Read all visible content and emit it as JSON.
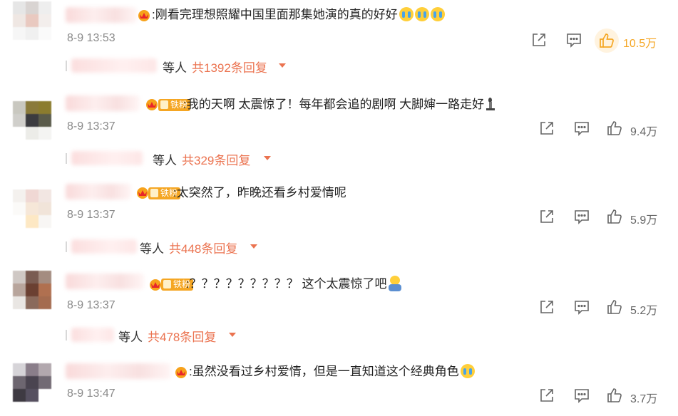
{
  "comments": [
    {
      "text": ":刚看完理想照耀中国里面那集她演的真的好好",
      "emojis": [
        "crying-emoji",
        "crying-emoji",
        "crying-emoji"
      ],
      "has_fan_badge": false,
      "time": "8-9 13:53",
      "likes": "10.5万",
      "liked": true,
      "reply_who": "等人",
      "reply_count": "共1392条回复"
    },
    {
      "text": ":我的天啊 太震惊了！每年都会追的剧啊 大脚婶一路走好",
      "emojis": [
        "candle-emoji"
      ],
      "has_fan_badge": true,
      "badge": "铁粉",
      "time": "8-9 13:37",
      "likes": "9.4万",
      "liked": false,
      "reply_who": "等人",
      "reply_count": "共329条回复"
    },
    {
      "text": ":太突然了，昨晚还看乡村爱情呢",
      "emojis": [],
      "has_fan_badge": true,
      "badge": "铁粉",
      "time": "8-9 13:37",
      "likes": "5.9万",
      "liked": false,
      "reply_who": "等人",
      "reply_count": "共448条回复"
    },
    {
      "text": ":？？？？？？？？？ 这个太震惊了吧",
      "emojis": [
        "shocked-emoji"
      ],
      "has_fan_badge": true,
      "badge": "铁粉",
      "time": "8-9 13:37",
      "likes": "5.2万",
      "liked": false,
      "reply_who": "等人",
      "reply_count": "共478条回复"
    },
    {
      "text": ":虽然没看过乡村爱情，但是一直知道这个经典角色",
      "emojis": [
        "crying-emoji"
      ],
      "has_fan_badge": false,
      "time": "8-9 13:47",
      "likes": "3.7万",
      "liked": false
    }
  ],
  "colors": {
    "accent": "#eb7350",
    "like_active": "#f5a623",
    "badge": "#f5a623",
    "muted": "#8a8a8a"
  }
}
